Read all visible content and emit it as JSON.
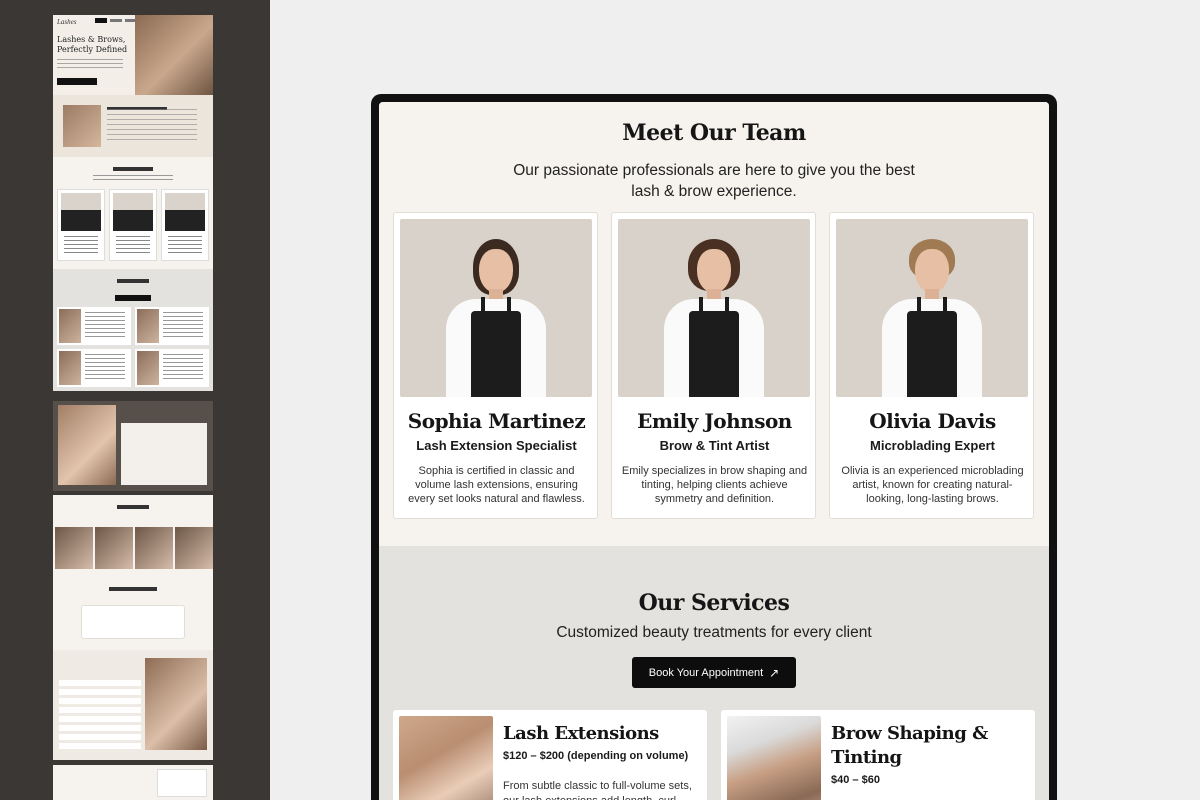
{
  "thumbnails": {
    "hero_logo": "Lashes",
    "hero_headline": "Lashes & Brows, Perfectly Defined"
  },
  "team": {
    "title": "Meet Our Team",
    "subtitle": "Our passionate professionals are here to give you the best lash & brow experience.",
    "members": [
      {
        "name": "Sophia Martinez",
        "role": "Lash Extension Specialist",
        "bio": "Sophia is certified in classic and volume lash extensions, ensuring every set looks natural and flawless."
      },
      {
        "name": "Emily Johnson",
        "role": "Brow & Tint Artist",
        "bio": "Emily specializes in brow shaping and tinting, helping clients achieve symmetry and definition."
      },
      {
        "name": "Olivia Davis",
        "role": "Microblading Expert",
        "bio": "Olivia is an experienced microblading artist, known for creating natural-looking, long-lasting brows."
      }
    ]
  },
  "services": {
    "title": "Our Services",
    "subtitle": "Customized beauty treatments for every client",
    "cta_label": "Book Your Appointment",
    "cta_icon": "arrow-up-right-icon",
    "items": [
      {
        "title": "Lash Extensions",
        "price": "$120 – $200 (depending on volume)",
        "desc": "From subtle classic to full-volume sets, our lash extensions add length, curl, and"
      },
      {
        "title": "Brow Shaping & Tinting",
        "price": "$40 – $60",
        "desc": ""
      }
    ]
  },
  "colors": {
    "cream": "#f6f3ee",
    "grey_section": "#e4e2de",
    "dark": "#0d0d0d",
    "sidebar": "#3a3734"
  }
}
